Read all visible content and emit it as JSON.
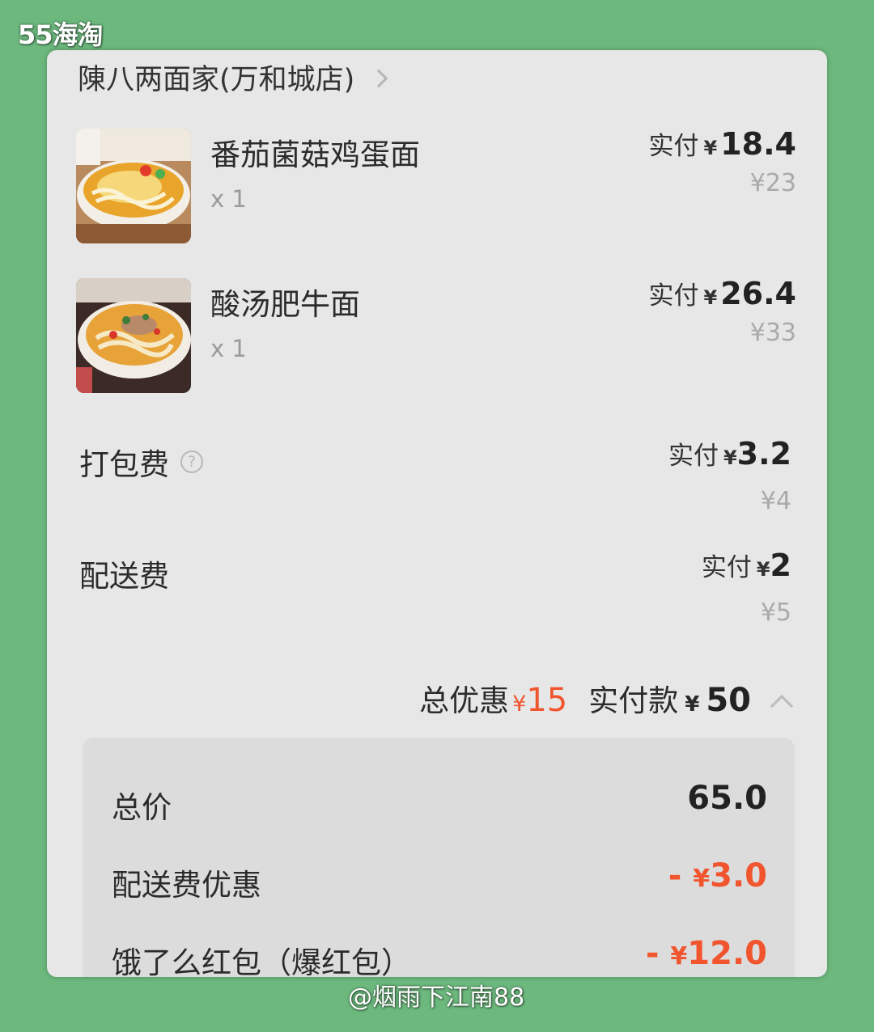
{
  "watermark_top": "55海淘",
  "watermark_bottom": "@烟雨下江南88",
  "shop": {
    "name": "陳八两面家(万和城店)"
  },
  "items": [
    {
      "name": "番茄菌菇鸡蛋面",
      "qty": "x 1",
      "paid_label": "实付",
      "currency": "¥",
      "paid_amount": "18.4",
      "original_price": "¥23"
    },
    {
      "name": "酸汤肥牛面",
      "qty": "x 1",
      "paid_label": "实付",
      "currency": "¥",
      "paid_amount": "26.4",
      "original_price": "¥33"
    }
  ],
  "fees": [
    {
      "label": "打包费",
      "help_icon": "?",
      "paid_label": "实付",
      "currency": "¥",
      "paid_amount": "3.2",
      "original_price": "¥4"
    },
    {
      "label": "配送费",
      "paid_label": "实付",
      "currency": "¥",
      "paid_amount": "2",
      "original_price": "¥5"
    }
  ],
  "summary": {
    "discount_label": "总优惠",
    "discount_currency": "¥",
    "discount_amount": "15",
    "pay_label": "实付款",
    "pay_currency": "¥",
    "pay_amount": "50"
  },
  "breakdown": [
    {
      "label": "总价",
      "value": "65.0",
      "prefix": "",
      "currency": ""
    },
    {
      "label": "配送费优惠",
      "value": "3.0",
      "prefix": "-",
      "currency": "¥"
    },
    {
      "label": "饿了么红包（爆红包）",
      "value": "12.0",
      "prefix": "-",
      "currency": "¥"
    }
  ],
  "colors": {
    "background": "#6cb87d",
    "card": "#e7e7e7",
    "panel": "#dcdcdc",
    "discount_red": "#f0552e"
  }
}
